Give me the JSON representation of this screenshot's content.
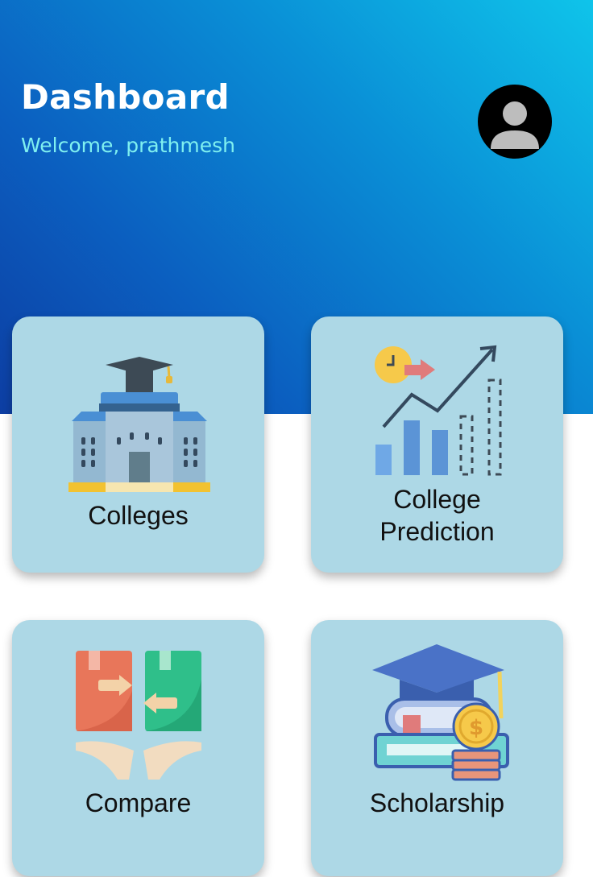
{
  "header": {
    "title": "Dashboard",
    "welcome": "Welcome, prathmesh",
    "avatar_icon": "user-avatar-icon"
  },
  "cards": [
    {
      "label": "Colleges",
      "icon": "university-building-icon"
    },
    {
      "label_line1": "College",
      "label_line2": "Prediction",
      "icon": "growth-chart-icon"
    },
    {
      "label": "Compare",
      "icon": "compare-books-icon"
    },
    {
      "label": "Scholarship",
      "icon": "graduation-books-coins-icon"
    }
  ],
  "colors": {
    "header_gradient_start": "#0fc4ea",
    "header_gradient_end": "#0d3ea3",
    "card_background": "#add8e6",
    "welcome_text": "#7ff0f0"
  }
}
